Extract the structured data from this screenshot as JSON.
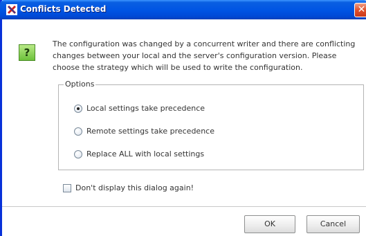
{
  "window": {
    "title": "Conflicts Detected",
    "close_label": "✕"
  },
  "message": {
    "lines": [
      "The configuration was changed by a concurrent writer and there are conflicting",
      "changes between your local and the server's configuration version. Please",
      "choose the strategy which will be used to write the configuration."
    ]
  },
  "options": {
    "legend": "Options",
    "items": [
      {
        "label": "Local settings take precedence",
        "checked": true
      },
      {
        "label": "Remote settings take precedence",
        "checked": false
      },
      {
        "label": "Replace ALL with local settings",
        "checked": false
      }
    ]
  },
  "dont_display": {
    "label": "Don't display this dialog again!",
    "checked": false
  },
  "buttons": {
    "ok": "OK",
    "cancel": "Cancel"
  },
  "icons": {
    "help": "?"
  }
}
